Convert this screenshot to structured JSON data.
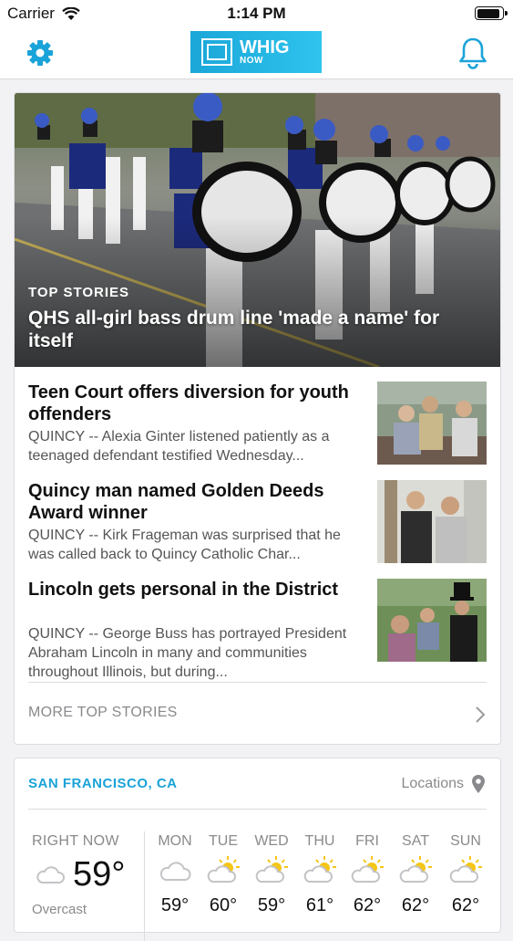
{
  "status_bar": {
    "carrier": "Carrier",
    "time": "1:14 PM"
  },
  "nav": {
    "logo_main": "WHIG",
    "logo_sub": "NOW"
  },
  "hero": {
    "label": "TOP STORIES",
    "title": "QHS all-girl bass drum line 'made a name' for itself"
  },
  "stories": [
    {
      "title": "Teen Court offers diversion for youth offenders",
      "summary": "QUINCY -- Alexia Ginter listened patiently as a teenaged defendant testified Wednesday..."
    },
    {
      "title": "Quincy man named Golden Deeds Award winner",
      "summary": "QUINCY -- Kirk Frageman was surprised that he was called back to Quincy Catholic Char..."
    },
    {
      "title": "Lincoln gets personal in the District",
      "summary": "QUINCY -- George Buss has portrayed President Abraham Lincoln in many and communities throughout Illinois, but during..."
    }
  ],
  "more_label": "MORE TOP STORIES",
  "weather": {
    "city": "SAN FRANCISCO, CA",
    "locations_label": "Locations",
    "right_now": {
      "label": "RIGHT NOW",
      "temp": "59°",
      "condition": "Overcast"
    },
    "days": [
      {
        "name": "MON",
        "icon": "cloud-icon",
        "temp": "59°"
      },
      {
        "name": "TUE",
        "icon": "partly-sunny-icon",
        "temp": "60°"
      },
      {
        "name": "WED",
        "icon": "partly-sunny-icon",
        "temp": "59°"
      },
      {
        "name": "THU",
        "icon": "partly-sunny-icon",
        "temp": "61°"
      },
      {
        "name": "FRI",
        "icon": "partly-sunny-icon",
        "temp": "62°"
      },
      {
        "name": "SAT",
        "icon": "partly-sunny-icon",
        "temp": "62°"
      },
      {
        "name": "SUN",
        "icon": "partly-sunny-icon",
        "temp": "62°"
      }
    ]
  },
  "colors": {
    "accent": "#1aa3d8",
    "logo_bg": "#1ba7d8"
  }
}
